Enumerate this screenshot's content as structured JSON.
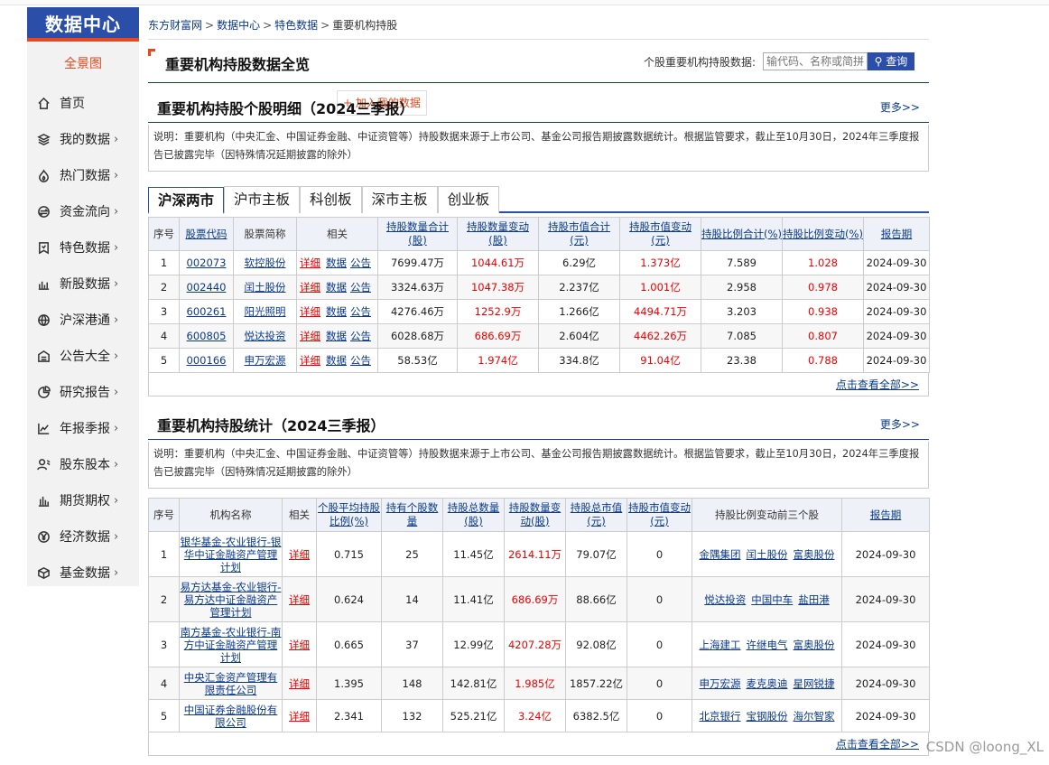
{
  "sidebar": {
    "logo": "数据中心",
    "overview": "全景图",
    "items": [
      {
        "label": "首页",
        "icon": "home-icon",
        "arrow": ""
      },
      {
        "label": "我的数据",
        "icon": "layers-icon",
        "arrow": "›"
      },
      {
        "label": "热门数据",
        "icon": "fire-icon",
        "arrow": "›"
      },
      {
        "label": "资金流向",
        "icon": "flow-icon",
        "arrow": "›"
      },
      {
        "label": "特色数据",
        "icon": "bookmark-icon",
        "arrow": "›"
      },
      {
        "label": "新股数据",
        "icon": "bars-icon",
        "arrow": "›"
      },
      {
        "label": "沪深港通",
        "icon": "globe-icon",
        "arrow": "›"
      },
      {
        "label": "公告大全",
        "icon": "building-icon",
        "arrow": "›"
      },
      {
        "label": "研究报告",
        "icon": "pie-icon",
        "arrow": "›"
      },
      {
        "label": "年报季报",
        "icon": "line-chart-icon",
        "arrow": "›"
      },
      {
        "label": "股东股本",
        "icon": "user-icon",
        "arrow": "›"
      },
      {
        "label": "期货期权",
        "icon": "column-chart-icon",
        "arrow": "›"
      },
      {
        "label": "经济数据",
        "icon": "yen-icon",
        "arrow": "›"
      },
      {
        "label": "基金数据",
        "icon": "cube-icon",
        "arrow": "›"
      }
    ]
  },
  "breadcrumb": {
    "home": "东方财富网",
    "sep": ">",
    "data_center": "数据中心",
    "special": "特色数据",
    "current": "重要机构持股"
  },
  "header": {
    "title": "重要机构持股数据全览",
    "add_button": "+ 加入我的数据",
    "search_label": "个股重要机构持股数据:",
    "search_placeholder": "输代码、名称或简拼",
    "search_button": "查询"
  },
  "section1": {
    "title": "重要机构持股个股明细（2024三季报）",
    "more": "更多>>",
    "note": "说明：重要机构（中央汇金、中国证券金融、中证资管等）持股数据来源于上市公司、基金公司报告期披露数据统计。根据监管要求，截止至10月30日，2024年三季度报告已披露完毕（因特殊情况延期披露的除外）",
    "tabs": [
      "沪深两市",
      "沪市主板",
      "科创板",
      "深市主板",
      "创业板"
    ],
    "columns": [
      "序号",
      "股票代码",
      "股票简称",
      "相关",
      "持股数量合计(股)",
      "持股数量变动(股)",
      "持股市值合计(元)",
      "持股市值变动(元)",
      "持股比例合计(%)",
      "持股比例变动(%)",
      "报告期"
    ],
    "links": [
      "详细",
      "数据",
      "公告"
    ],
    "rows": [
      {
        "no": "1",
        "code": "002073",
        "name": "软控股份",
        "qty": "7699.47万",
        "qty_chg": "1044.61万",
        "mv": "6.29亿",
        "mv_chg": "1.373亿",
        "ratio": "7.589",
        "ratio_chg": "1.028",
        "date": "2024-09-30"
      },
      {
        "no": "2",
        "code": "002440",
        "name": "闰土股份",
        "qty": "3324.63万",
        "qty_chg": "1047.38万",
        "mv": "2.237亿",
        "mv_chg": "1.001亿",
        "ratio": "2.958",
        "ratio_chg": "0.978",
        "date": "2024-09-30"
      },
      {
        "no": "3",
        "code": "600261",
        "name": "阳光照明",
        "qty": "4276.46万",
        "qty_chg": "1252.9万",
        "mv": "1.266亿",
        "mv_chg": "4494.71万",
        "ratio": "3.203",
        "ratio_chg": "0.938",
        "date": "2024-09-30"
      },
      {
        "no": "4",
        "code": "600805",
        "name": "悦达投资",
        "qty": "6028.68万",
        "qty_chg": "686.69万",
        "mv": "2.604亿",
        "mv_chg": "4462.26万",
        "ratio": "7.085",
        "ratio_chg": "0.807",
        "date": "2024-09-30"
      },
      {
        "no": "5",
        "code": "000166",
        "name": "申万宏源",
        "qty": "58.53亿",
        "qty_chg": "1.974亿",
        "mv": "334.8亿",
        "mv_chg": "91.04亿",
        "ratio": "23.38",
        "ratio_chg": "0.788",
        "date": "2024-09-30"
      }
    ],
    "view_all": "点击查看全部>>"
  },
  "section2": {
    "title": "重要机构持股统计（2024三季报）",
    "more": "更多>>",
    "note": "说明：重要机构（中央汇金、中国证券金融、中证资管等）持股数据来源于上市公司、基金公司报告期披露数据统计。根据监管要求，截止至10月30日，2024年三季度报告已披露完毕（因特殊情况延期披露的除外）",
    "columns": [
      "序号",
      "机构名称",
      "相关",
      "个股平均持股比例(%)",
      "持有个股数量",
      "持股总数量(股)",
      "持股数量变动(股)",
      "持股总市值(元)",
      "持股市值变动(元)",
      "持股比例变动前三个股",
      "报告期"
    ],
    "link": "详细",
    "rows": [
      {
        "no": "1",
        "org": "银华基金-农业银行-银华中证金融资产管理计划",
        "avg": "0.715",
        "cnt": "25",
        "qty": "11.45亿",
        "qty_chg": "2614.11万",
        "mv": "79.07亿",
        "mv_chg": "0",
        "tops": [
          "金隅集团",
          "闰土股份",
          "富奥股份"
        ],
        "date": "2024-09-30"
      },
      {
        "no": "2",
        "org": "易方达基金-农业银行-易方达中证金融资产管理计划",
        "avg": "0.624",
        "cnt": "14",
        "qty": "11.41亿",
        "qty_chg": "686.69万",
        "mv": "88.66亿",
        "mv_chg": "0",
        "tops": [
          "悦达投资",
          "中国中车",
          "盐田港"
        ],
        "date": "2024-09-30"
      },
      {
        "no": "3",
        "org": "南方基金-农业银行-南方中证金融资产管理计划",
        "avg": "0.665",
        "cnt": "37",
        "qty": "12.99亿",
        "qty_chg": "4207.28万",
        "mv": "92.08亿",
        "mv_chg": "0",
        "tops": [
          "上海建工",
          "许继电气",
          "富奥股份"
        ],
        "date": "2024-09-30"
      },
      {
        "no": "4",
        "org": "中央汇金资产管理有限责任公司",
        "avg": "1.395",
        "cnt": "148",
        "qty": "142.81亿",
        "qty_chg": "1.985亿",
        "mv": "1857.22亿",
        "mv_chg": "0",
        "tops": [
          "申万宏源",
          "麦克奥迪",
          "星网锐捷"
        ],
        "date": "2024-09-30"
      },
      {
        "no": "5",
        "org": "中国证券金融股份有限公司",
        "avg": "2.341",
        "cnt": "132",
        "qty": "525.21亿",
        "qty_chg": "3.24亿",
        "mv": "6382.5亿",
        "mv_chg": "0",
        "tops": [
          "北京银行",
          "宝钢股份",
          "海尔智家"
        ],
        "date": "2024-09-30"
      }
    ],
    "view_all": "点击查看全部>>"
  },
  "watermark": "CSDN @loong_XL"
}
